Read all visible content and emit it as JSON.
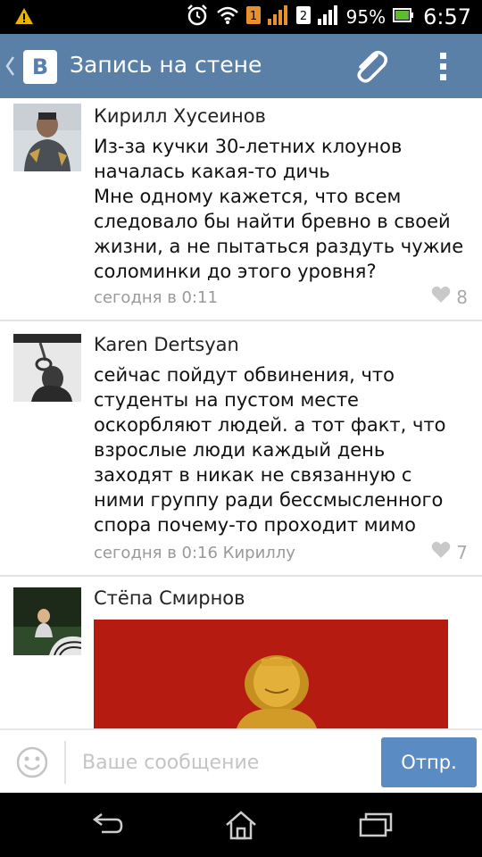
{
  "status_bar": {
    "battery": "95%",
    "time": "6:57",
    "sim1": "1",
    "sim2": "2"
  },
  "header": {
    "logo": "B",
    "title": "Запись на стене"
  },
  "comments": [
    {
      "author": "Кирилл Хусеинов",
      "text": "Из-за кучки 30-летних клоунов\nначалась какая-то дичь\nМне одному кажется, что всем\nследовало бы найти бревно в своей\nжизни, а не пытаться раздуть чужие\nсоломинки до этого уровня?",
      "time": "сегодня в 0:11",
      "likes": "8"
    },
    {
      "author": "Karen Dertsyan",
      "text": "сейчас пойдут обвинения, что\nстуденты на пустом месте\nоскорбляют людей. а тот факт, что\nвзрослые люди каждый день\nзаходят в никак не связанную с\nними группу ради бессмысленного\nспора почему-то проходит мимо",
      "time": "сегодня в 0:16 Кириллу",
      "likes": "7"
    },
    {
      "author": "Стёпа Смирнов"
    }
  ],
  "composer": {
    "placeholder": "Ваше сообщение",
    "send_label": "Отпр."
  },
  "colors": {
    "header_bg": "#5b80a8",
    "send_button": "#5a8bc3",
    "meta_text": "#999999"
  },
  "icons": [
    "warning-icon",
    "alarm-icon",
    "wifi-icon",
    "signal-icon",
    "battery-icon",
    "back-chevron-icon",
    "paperclip-icon",
    "overflow-menu-icon",
    "heart-icon",
    "smile-icon",
    "nav-back-icon",
    "nav-home-icon",
    "nav-recents-icon"
  ]
}
